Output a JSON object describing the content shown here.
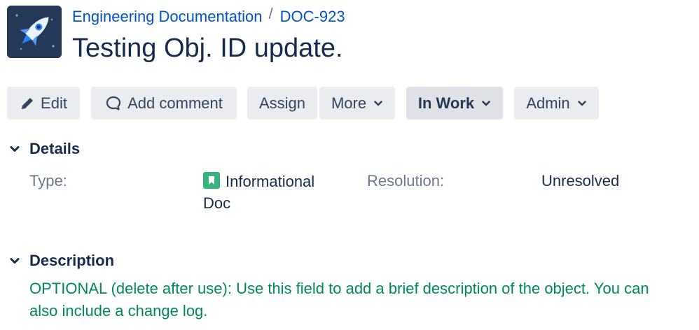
{
  "header": {
    "project_name": "Engineering Documentation",
    "separator": "/",
    "issue_key": "DOC-923",
    "title": "Testing Obj. ID update.",
    "avatar_icon": "rocket-icon",
    "avatar_bg": "#253858"
  },
  "toolbar": {
    "edit_label": "Edit",
    "comment_label": "Add comment",
    "assign_label": "Assign",
    "more_label": "More",
    "status_label": "In Work",
    "admin_label": "Admin"
  },
  "details": {
    "heading": "Details",
    "type_label": "Type:",
    "type_value_line1": "Informational",
    "type_value_line2": "Doc",
    "type_icon": "bookmark-icon",
    "type_icon_color": "#36B37E",
    "resolution_label": "Resolution:",
    "resolution_value": "Unresolved"
  },
  "description": {
    "heading": "Description",
    "text_line1": "OPTIONAL (delete after use): Use this field to add a brief description of the object. You can",
    "text_line2": "also include a change log.",
    "text_color": "#00875A"
  },
  "colors": {
    "link": "#0052CC",
    "button_bg": "#EBECF0",
    "status_button_bg": "#DFE1E6",
    "text": "#172B4D",
    "label": "#6B778C"
  }
}
